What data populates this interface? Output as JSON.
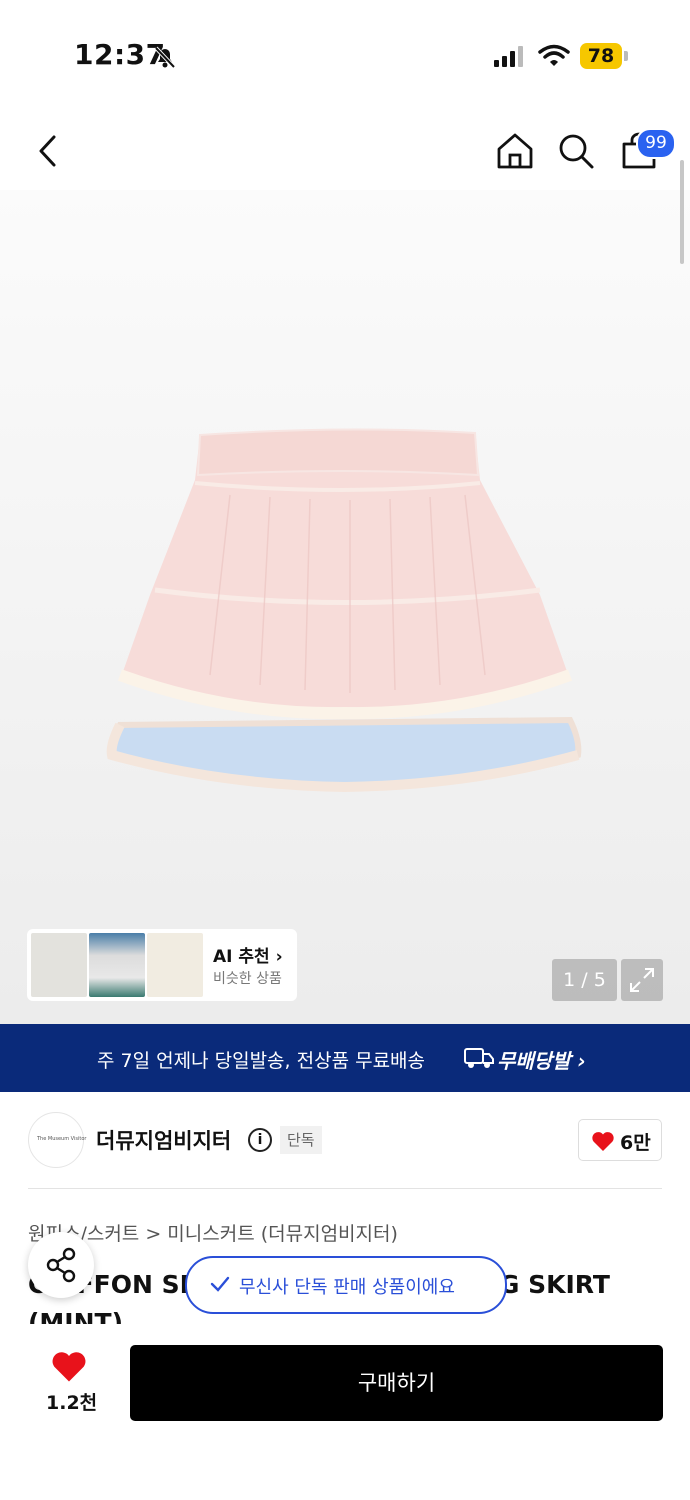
{
  "status_bar": {
    "time": "12:37",
    "battery": "78"
  },
  "header": {
    "cart_count": "99"
  },
  "gallery": {
    "page_indicator": "1 / 5"
  },
  "ai_reco": {
    "title": "AI 추천",
    "subtitle": "비슷한 상품"
  },
  "banner": {
    "text": "주 7일 언제나 당일발송, 전상품 무료배송",
    "brand": "무배당발"
  },
  "brand": {
    "logo_text": "The Museum Visitor",
    "name": "더뮤지엄비지터",
    "badge": "단독",
    "like_count": "6만"
  },
  "product": {
    "breadcrumb": "원피스/스커트 > 미니스커트 (더뮤지엄비지터)",
    "title": "CHIFFON SHIRRING LAYERED LONG SKIRT (MINT)"
  },
  "toast": {
    "text": "무신사 단독 판매 상품이에요"
  },
  "bottom": {
    "like_count": "1.2천",
    "buy_label": "구매하기"
  },
  "colors": {
    "banner_bg": "#0a2a7a",
    "accent_blue": "#2a4fd8",
    "like_red": "#e8121b",
    "buy_bg": "#000000"
  }
}
